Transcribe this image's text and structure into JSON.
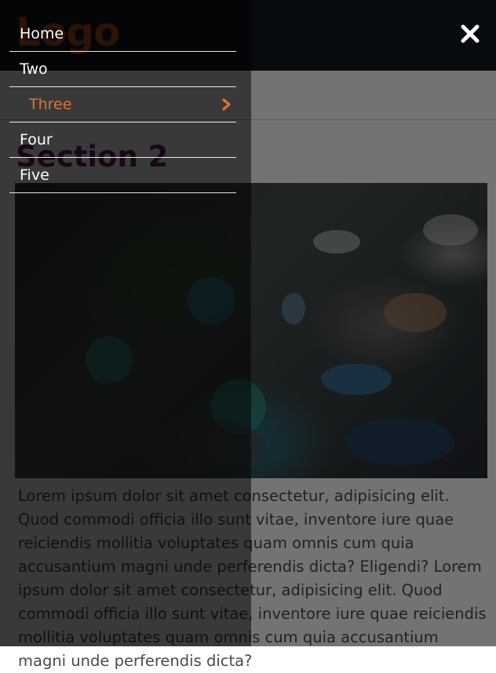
{
  "header": {
    "logo_text": "Logo",
    "close_icon": "close-icon"
  },
  "main": {
    "section_title": "Section 2",
    "body_text": "Lorem ipsum dolor sit amet consectetur, adipisicing elit. Quod commodi officia illo sunt vitae, inventore iure quae reiciendis mollitia voluptates quam omnis cum quia accusantium magni unde perferendis dicta? Eligendi? Lorem ipsum dolor sit amet consectetur, adipisicing elit. Quod commodi officia illo sunt vitae, inventore iure quae reiciendis mollitia voluptates quam omnis cum quia accusantium magni unde perferendis dicta?"
  },
  "menu": {
    "items": [
      {
        "label": "Home"
      },
      {
        "label": "Two"
      },
      {
        "label": "Three",
        "active": true,
        "icon": "chevron-right-icon"
      },
      {
        "label": "Four"
      },
      {
        "label": "Five"
      }
    ]
  },
  "colors": {
    "accent": "#e0742b",
    "header_bg": "#101721",
    "section_title": "#6b1f6b"
  }
}
